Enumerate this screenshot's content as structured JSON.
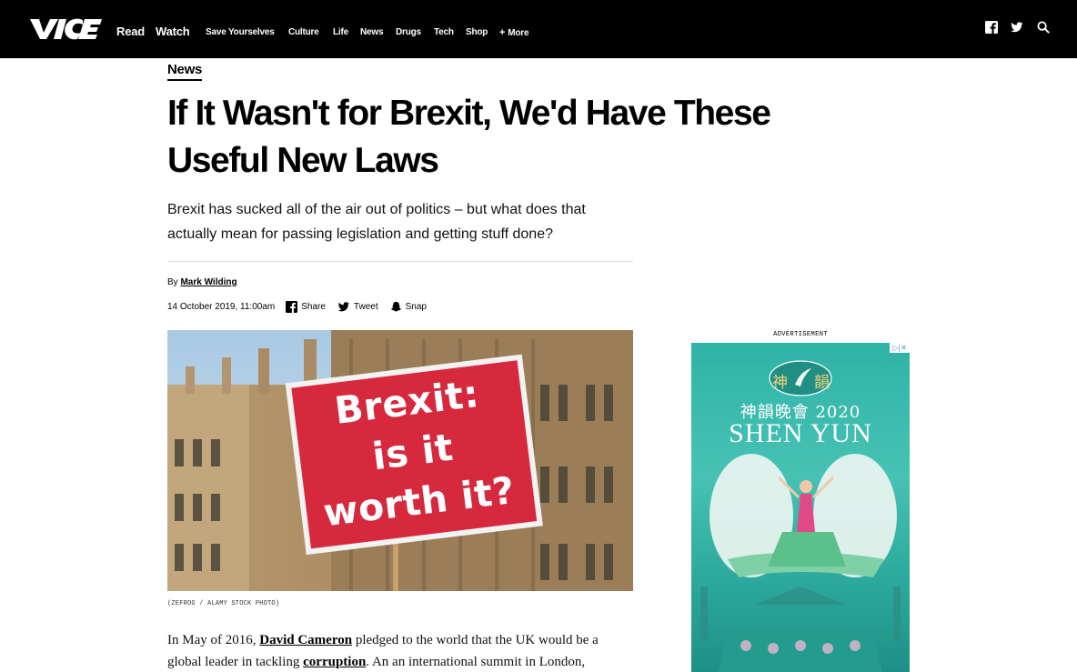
{
  "header": {
    "brand": "VICE",
    "primary_nav": [
      "Read",
      "Watch"
    ],
    "secondary_nav": [
      "Save Yourselves",
      "Culture",
      "Life",
      "News",
      "Drugs",
      "Tech",
      "Shop"
    ],
    "more_label": "More",
    "icons": [
      "facebook-icon",
      "twitter-icon",
      "search-icon"
    ]
  },
  "article": {
    "section": "News",
    "headline_line1": "If It Wasn't for Brexit, We'd Have These",
    "headline_line2": "Useful New Laws",
    "dek_line1": "Brexit has sucked all of the air out of politics – but what does that",
    "dek_line2": "actually mean for passing legislation and getting stuff done?",
    "by_prefix": "By",
    "author": "Mark Wilding",
    "date": "14 October 2019, 11:00am",
    "share_buttons": [
      {
        "label": "Share",
        "icon": "facebook-icon"
      },
      {
        "label": "Tweet",
        "icon": "twitter-icon"
      },
      {
        "label": "Snap",
        "icon": "snapchat-icon"
      }
    ],
    "hero_sign": [
      "Brexit:",
      "is it",
      "worth it?"
    ],
    "caption": "(ZEFROG / ALAMY STOCK PHOTO)",
    "body": {
      "p1_part1": "In May of 2016, ",
      "p1_link1": "David Cameron",
      "p1_part2": " pledged to the world that the UK would be a",
      "p1_part3": "global leader in tackling ",
      "p1_link2": "corruption",
      "p1_part4": ". An an international summit in London,"
    }
  },
  "ad": {
    "label": "ADVERTISEMENT",
    "close": "▷|✕",
    "badge_left": "神",
    "badge_right": "韻",
    "title_cn": "神韻晚會 2020",
    "title_en": "SHEN YUN"
  },
  "colors": {
    "topbar": "#000000",
    "sign_red": "#d6293e",
    "ad_teal": "#3bb9ab"
  }
}
